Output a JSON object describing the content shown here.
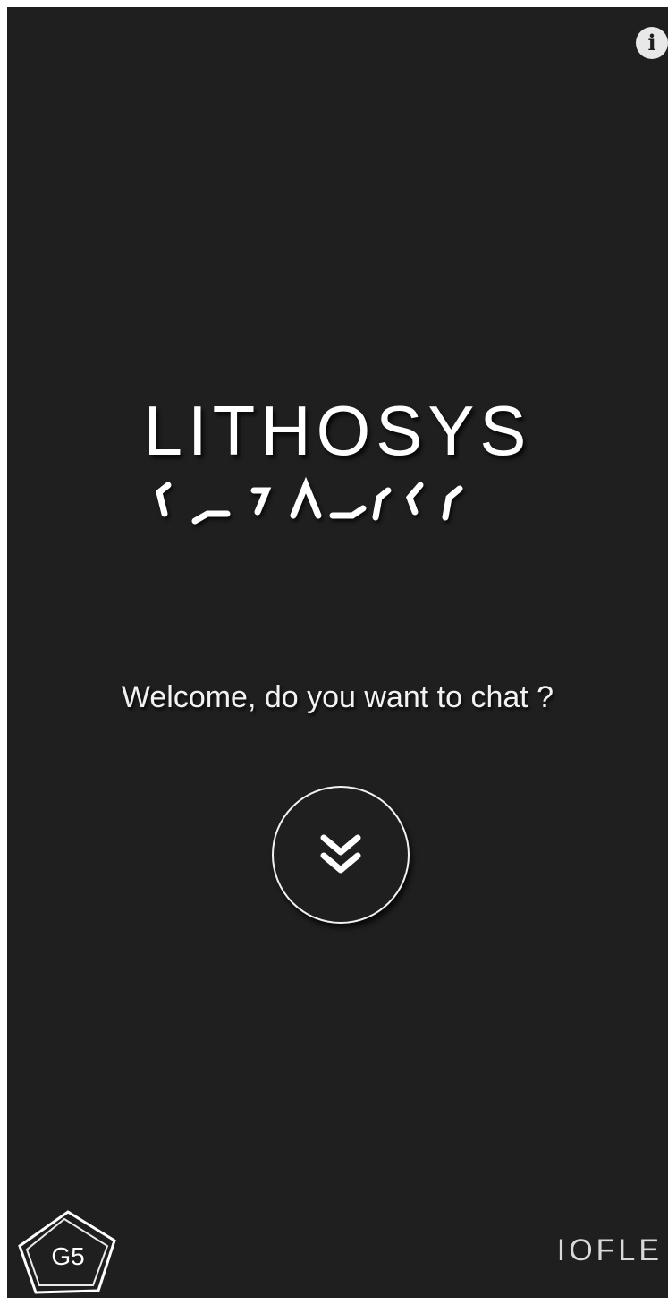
{
  "header": {
    "info_icon": "info-icon"
  },
  "logo": {
    "title": "LITHOSYS"
  },
  "welcome": {
    "message": "Welcome, do you want to chat ?"
  },
  "chat_button": {
    "icon": "double-chevron-down-icon"
  },
  "footer": {
    "badge_label": "G5",
    "brand_text": "IOFLE"
  },
  "colors": {
    "background": "#1f1f1f",
    "foreground": "#ffffff"
  }
}
